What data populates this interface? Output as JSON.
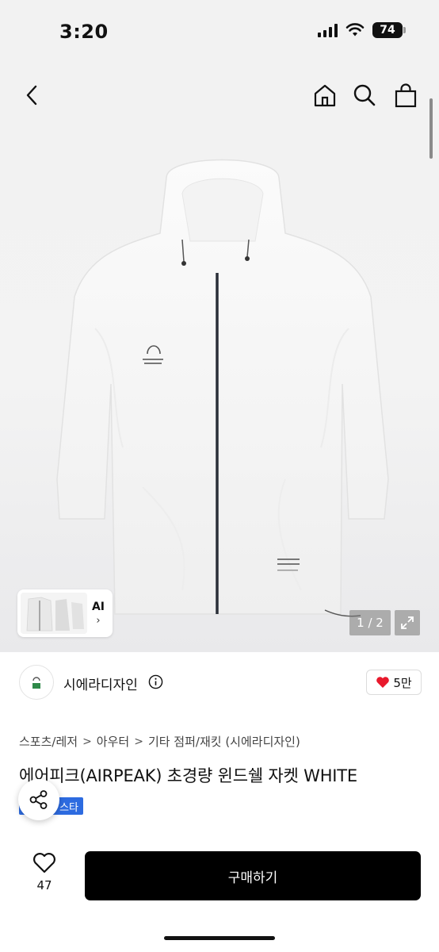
{
  "status_bar": {
    "time": "3:20",
    "battery": "74"
  },
  "product_image": {
    "page_indicator": "1 / 2",
    "thumbnail_label": "AI",
    "thumbnail_chevron": "›"
  },
  "shop": {
    "name": "시에라디자인",
    "likes": "5만"
  },
  "breadcrumb": [
    "스포츠/레저",
    "아우터",
    "기타 점퍼/재킷 (시에라디자인)"
  ],
  "product": {
    "title": "에어피크(AIRPEAK) 초경량 윈드쉘 자켓 WHITE",
    "tag": "스타"
  },
  "bottom_bar": {
    "favorite_count": "47",
    "buy_label": "구매하기"
  },
  "icons": {
    "back": "back-arrow-icon",
    "home": "home-icon",
    "search": "search-icon",
    "cart": "shopping-bag-icon",
    "expand": "expand-icon",
    "info": "info-icon",
    "heart": "heart-icon",
    "share": "share-icon"
  },
  "colors": {
    "like_heart": "#e8192c",
    "tag_bg": "#2d6be0",
    "buy_button": "#000000"
  }
}
